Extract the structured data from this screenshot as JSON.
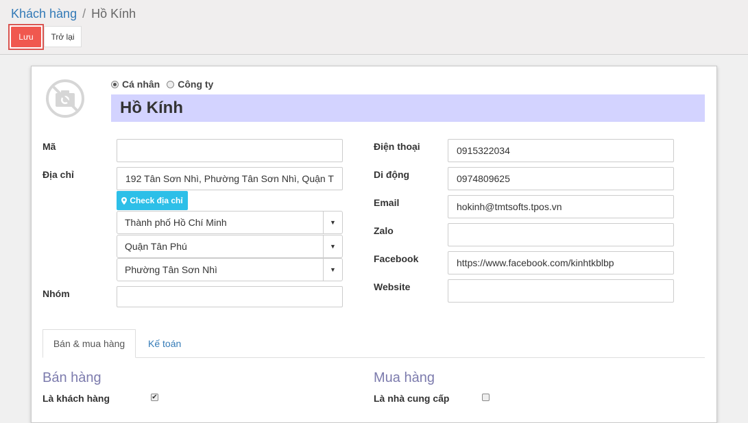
{
  "breadcrumb": {
    "parent": "Khách hàng",
    "separator": "/",
    "current": "Hồ Kính"
  },
  "toolbar": {
    "save_label": "Lưu",
    "back_label": "Trở lại"
  },
  "form": {
    "type_options": [
      {
        "label": "Cá nhân",
        "selected": true
      },
      {
        "label": "Công ty",
        "selected": false
      }
    ],
    "name": "Hồ Kính",
    "left": {
      "code_label": "Mã",
      "code_value": "",
      "address_label": "Địa chỉ",
      "address_value": "192 Tân Sơn Nhì, Phường Tân Sơn Nhì, Quận T",
      "check_address_label": "Check địa chỉ",
      "city": "Thành phố Hồ Chí Minh",
      "district": "Quận Tân Phú",
      "ward": "Phường Tân Sơn Nhì",
      "group_label": "Nhóm",
      "group_value": ""
    },
    "right": {
      "phone_label": "Điện thoại",
      "phone_value": "0915322034",
      "mobile_label": "Di động",
      "mobile_value": "0974809625",
      "email_label": "Email",
      "email_value": "hokinh@tmtsofts.tpos.vn",
      "zalo_label": "Zalo",
      "zalo_value": "",
      "facebook_label": "Facebook",
      "facebook_value": "https://www.facebook.com/kinhtkblbp",
      "website_label": "Website",
      "website_value": ""
    }
  },
  "tabs": [
    {
      "label": "Bán & mua hàng",
      "active": true
    },
    {
      "label": "Kế toán",
      "active": false
    }
  ],
  "sales": {
    "title": "Bán hàng",
    "is_customer_label": "Là khách hàng",
    "is_customer": true
  },
  "purchase": {
    "title": "Mua hàng",
    "is_supplier_label": "Là nhà cung cấp",
    "is_supplier": false
  },
  "colors": {
    "accent": "#337ab7",
    "save_button": "#f0584f",
    "name_bar": "#d3d3ff",
    "check_button": "#2dbfe8",
    "section_title": "#7c7bad"
  },
  "icons": {
    "avatar": "camera-placeholder-icon",
    "map_marker": "map-marker-icon",
    "dropdown": "caret-down-icon"
  }
}
